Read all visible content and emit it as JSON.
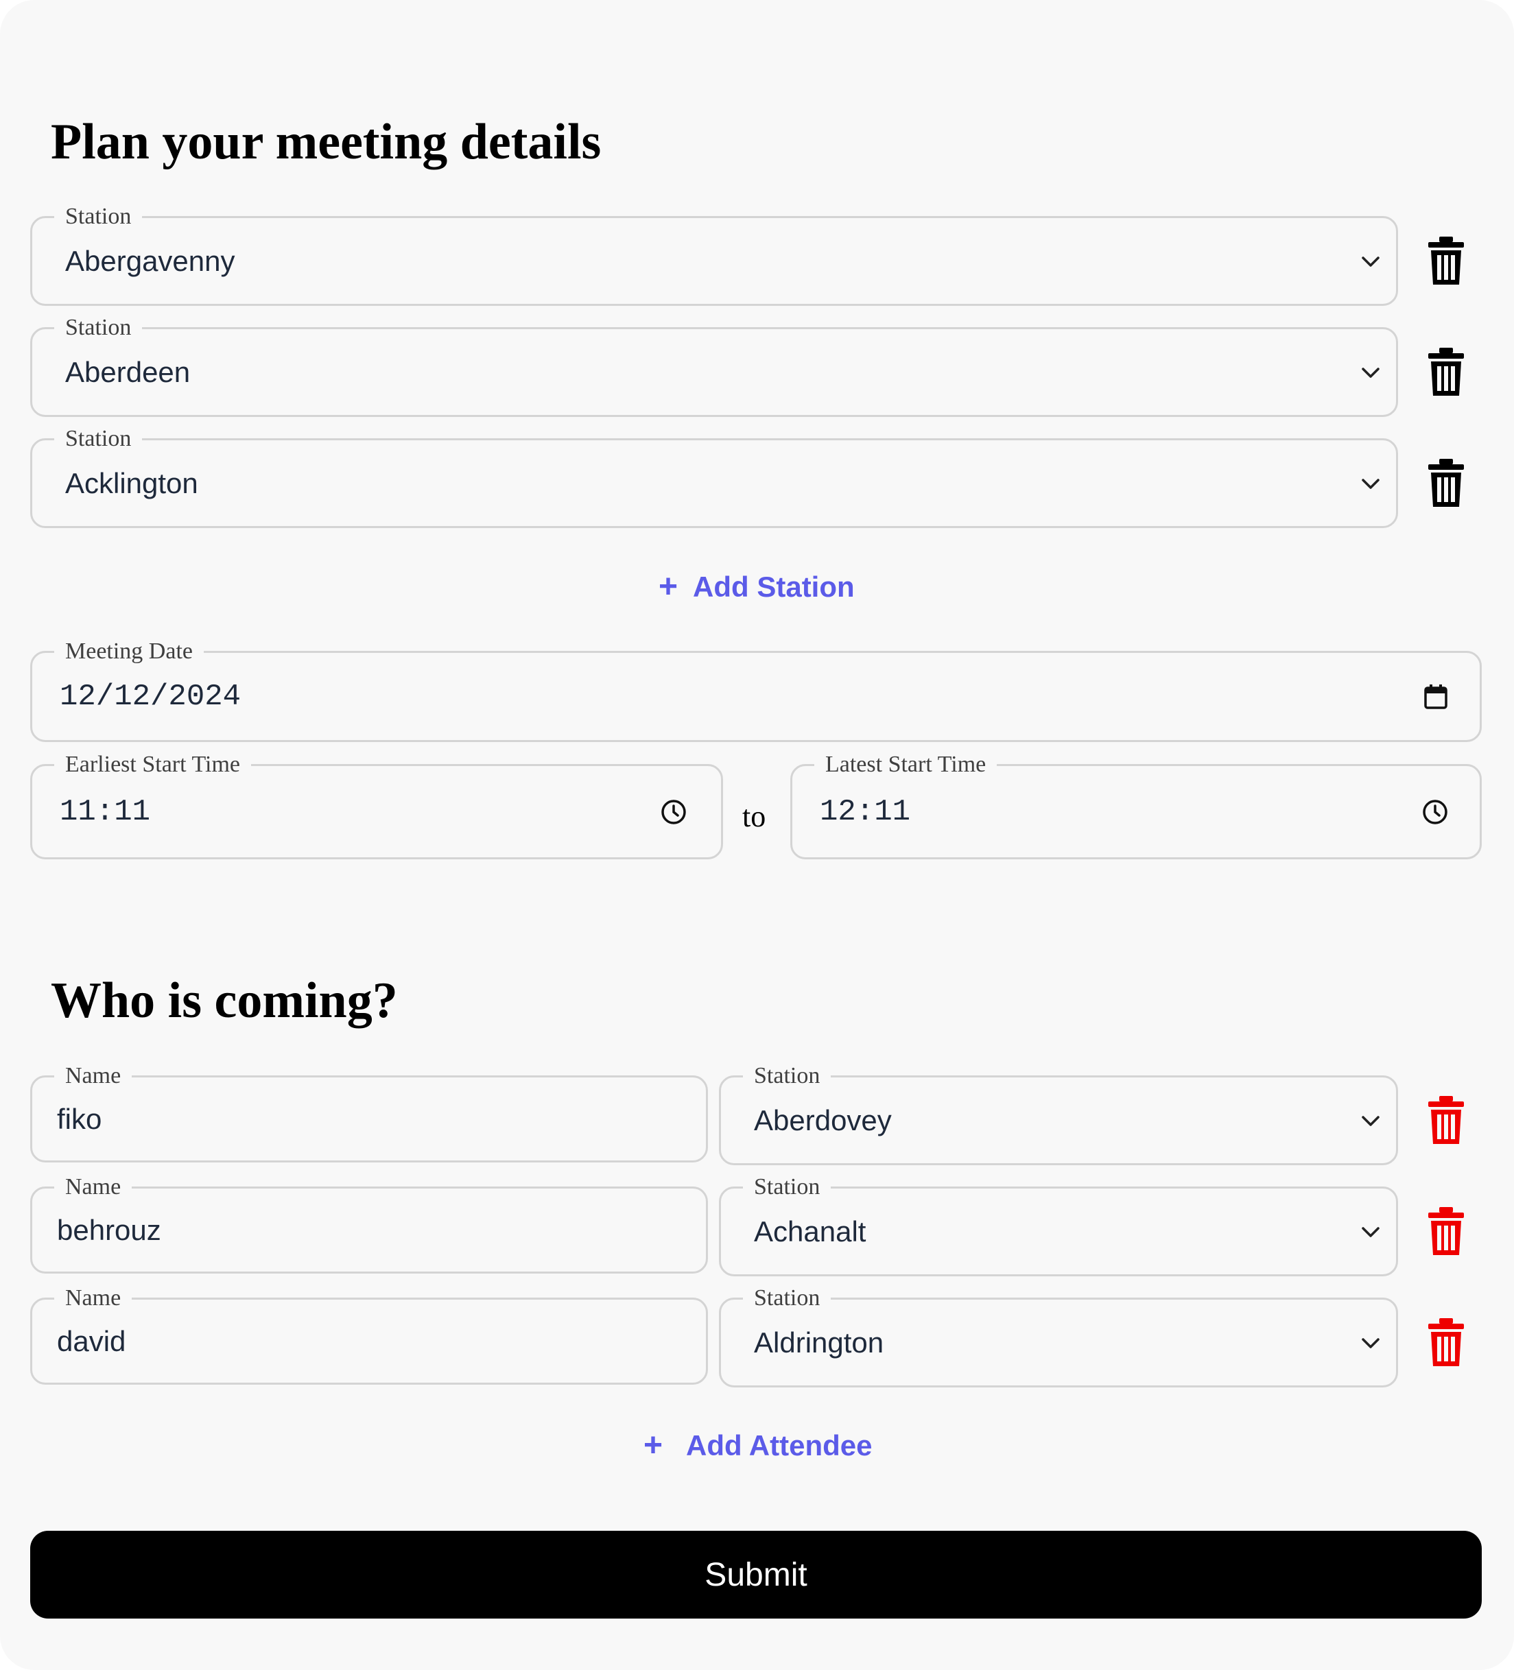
{
  "meeting": {
    "heading": "Plan your meeting details",
    "stations": [
      {
        "label": "Station",
        "value": "Abergavenny"
      },
      {
        "label": "Station",
        "value": "Aberdeen"
      },
      {
        "label": "Station",
        "value": "Acklington"
      }
    ],
    "add_station_label": "Add Station",
    "date": {
      "label": "Meeting Date",
      "value": "12/12/2024"
    },
    "earliest": {
      "label": "Earliest Start Time",
      "value": "11:11"
    },
    "separator": "to",
    "latest": {
      "label": "Latest Start Time",
      "value": "12:11"
    }
  },
  "attendees": {
    "heading": "Who is coming?",
    "rows": [
      {
        "name_label": "Name",
        "name": "fiko",
        "station_label": "Station",
        "station": "Aberdovey"
      },
      {
        "name_label": "Name",
        "name": "behrouz",
        "station_label": "Station",
        "station": "Achanalt"
      },
      {
        "name_label": "Name",
        "name": "david",
        "station_label": "Station",
        "station": "Aldrington"
      }
    ],
    "add_attendee_label": "Add Attendee"
  },
  "submit_label": "Submit",
  "colors": {
    "accent": "#5b5be8",
    "delete_attendee": "#ee0000",
    "delete_station": "#000000",
    "submit_bg": "#000000"
  }
}
